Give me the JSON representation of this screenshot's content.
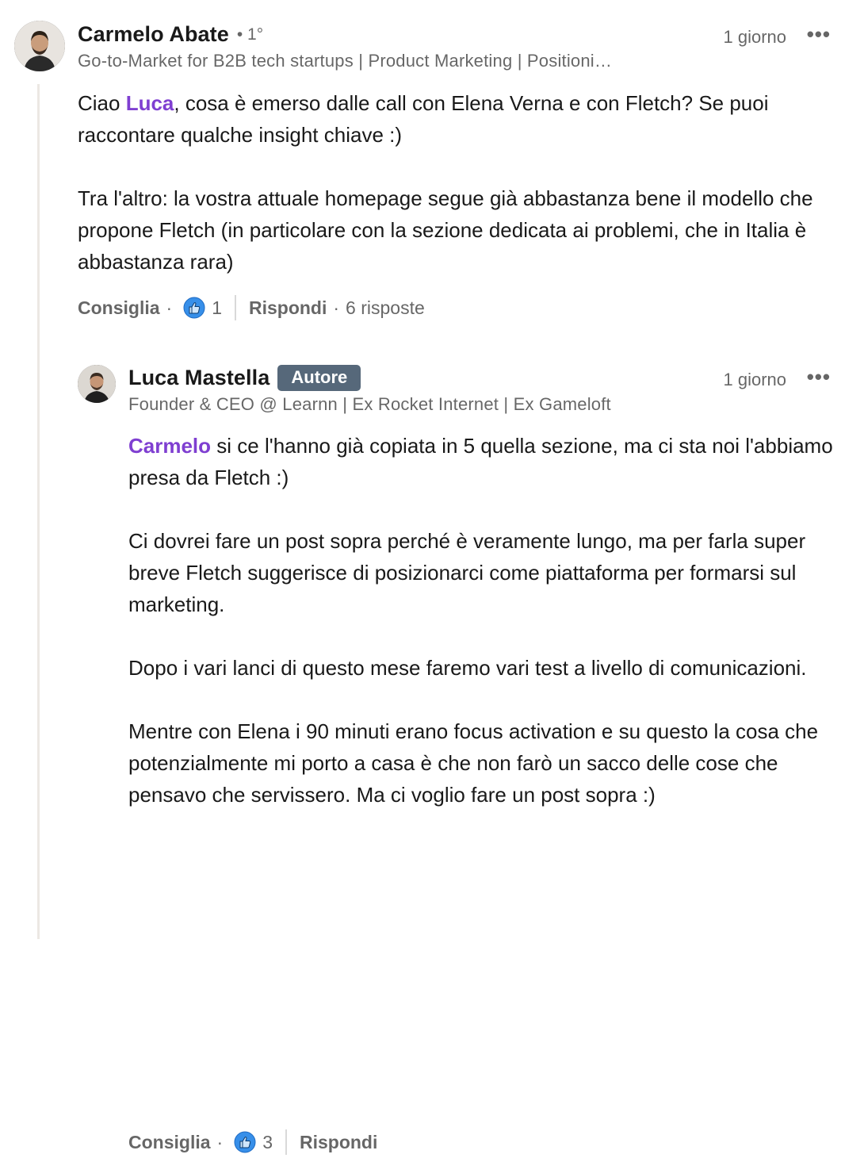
{
  "comments": [
    {
      "author": "Carmelo Abate",
      "degree": "• 1°",
      "headline": "Go-to-Market for B2B tech startups | Product Marketing | Positioni…",
      "time": "1 giorno",
      "more": "•••",
      "mention": "Luca",
      "para1_before": "Ciao ",
      "para1_after": ", cosa è emerso dalle call con Elena Verna e con Fletch? Se puoi raccontare qualche insight chiave :)",
      "para2": "Tra l'altro: la vostra attuale homepage segue già abbastanza bene il modello che propone Fletch (in particolare con la sezione dedicata ai problemi, che in Italia è abbastanza rara)",
      "like_label": "Consiglia",
      "like_count": "1",
      "reply_label": "Rispondi",
      "replies": "6 risposte"
    },
    {
      "author": "Luca Mastella",
      "badge": "Autore",
      "headline": "Founder & CEO @ Learnn | Ex Rocket Internet | Ex Gameloft",
      "time": "1 giorno",
      "more": "•••",
      "mention": "Carmelo",
      "para1_after": " si ce l'hanno già copiata in 5 quella sezione, ma ci sta noi l'abbiamo presa da Fletch :)",
      "para2": "Ci dovrei fare un post sopra perché è veramente lungo, ma per farla super breve Fletch suggerisce di posizionarci come piattaforma per formarsi sul marketing.",
      "para3": "Dopo i vari lanci di questo mese faremo vari test a livello di comunicazioni.",
      "para4": "Mentre con Elena i 90 minuti erano focus activation e su questo la cosa che potenzialmente mi porto a casa è che non farò un sacco delle cose che pensavo che servissero. Ma ci voglio fare un post sopra :)",
      "like_label": "Consiglia",
      "like_count": "3",
      "reply_label": "Rispondi"
    }
  ],
  "colors": {
    "mention": "#7f3fd1",
    "badge": "#56687a",
    "like_blue": "#378fe9",
    "thread_line": "#ece8e3"
  },
  "icons": [
    "thumbs-up-like-icon",
    "more-options-icon"
  ]
}
